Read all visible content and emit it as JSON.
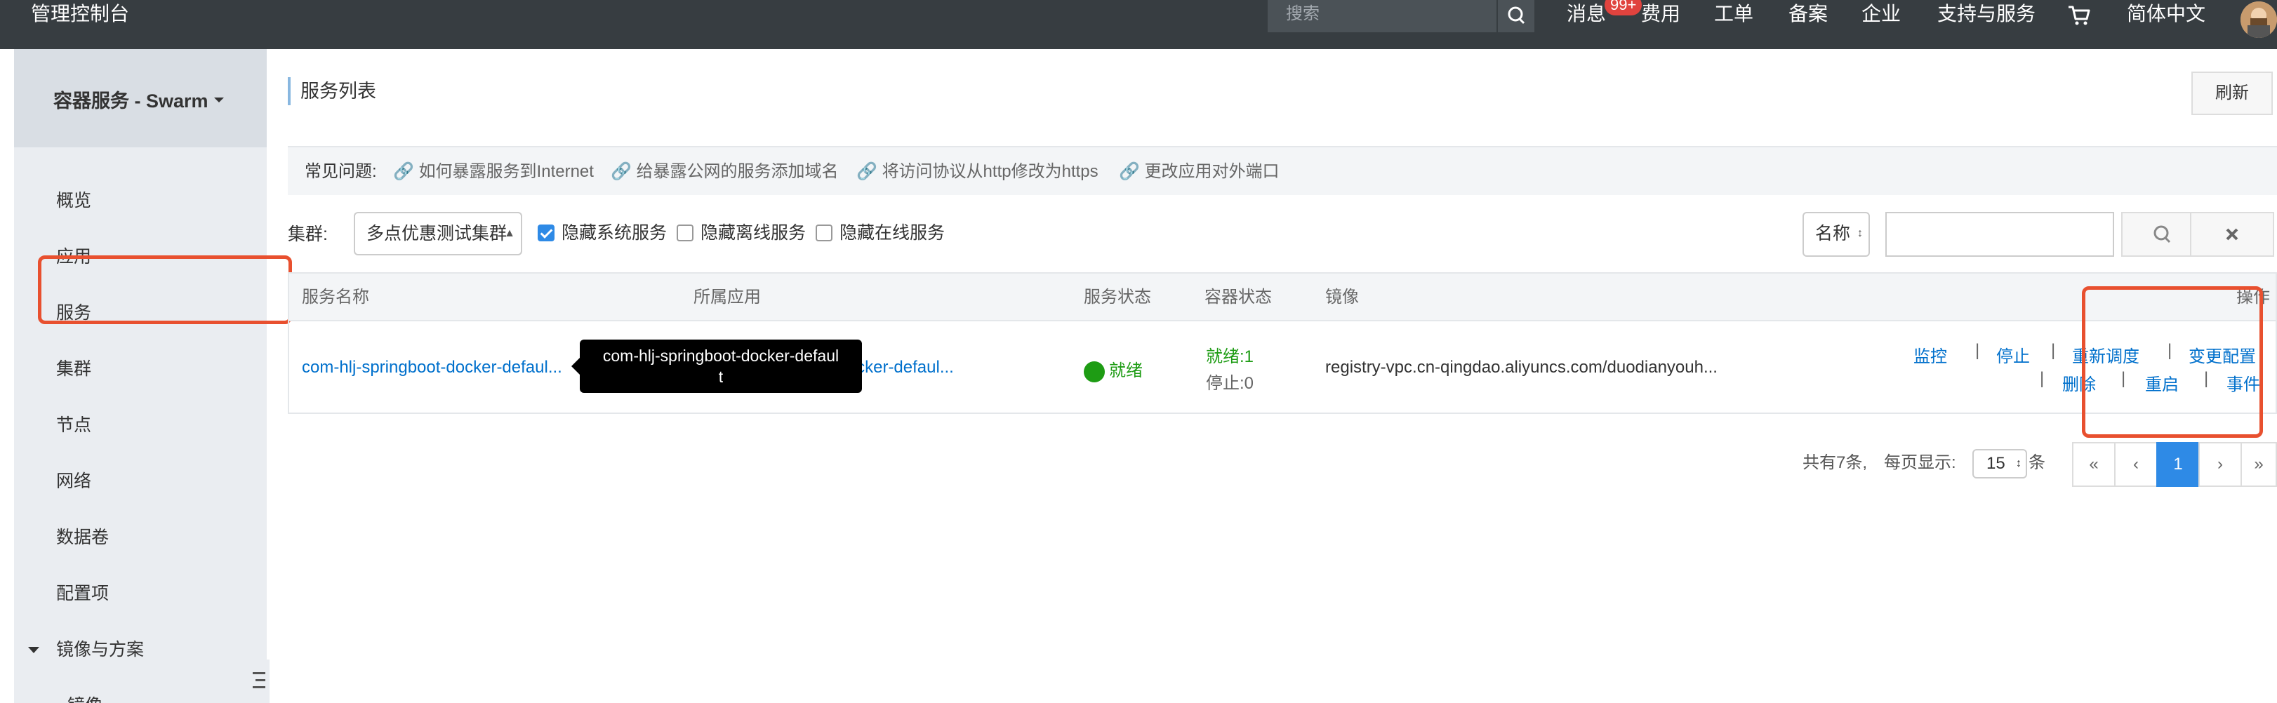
{
  "topbar": {
    "brand": "管理控制台",
    "search_placeholder": "搜索",
    "nav": [
      "消息",
      "费用",
      "工单",
      "备案",
      "企业",
      "支持与服务",
      "简体中文"
    ],
    "message_badge": "99+"
  },
  "sidebar": {
    "title": "容器服务 - Swarm",
    "items": [
      "概览",
      "应用",
      "服务",
      "集群",
      "节点",
      "网络",
      "数据卷",
      "配置项"
    ],
    "group": "镜像与方案",
    "sub_items": [
      "镜像"
    ]
  },
  "main": {
    "title": "服务列表",
    "refresh_label": "刷新",
    "faq_label": "常见问题:",
    "faq_links": [
      "如何暴露服务到Internet",
      "给暴露公网的服务添加域名",
      "将访问协议从http修改为https",
      "更改应用对外端口"
    ],
    "cluster_label": "集群:",
    "cluster_value": "多点优惠测试集群",
    "checkboxes": [
      {
        "label": "隐藏系统服务",
        "checked": true
      },
      {
        "label": "隐藏离线服务",
        "checked": false
      },
      {
        "label": "隐藏在线服务",
        "checked": false
      }
    ],
    "search_field_select": "名称"
  },
  "table": {
    "headers": [
      "服务名称",
      "所属应用",
      "服务状态",
      "容器状态",
      "镜像",
      "操作"
    ],
    "rows": [
      {
        "name": "com-hlj-springboot-docker-defaul...",
        "app": "com-hlj-springboot-docker-defaul...",
        "status": "就绪",
        "container_ready": "就绪:1",
        "container_stopped": "停止:0",
        "image": "registry-vpc.cn-qingdao.aliyuncs.com/duodianyouh...",
        "actions": [
          "监控",
          "停止",
          "重新调度",
          "变更配置",
          "删除",
          "重启",
          "事件"
        ]
      }
    ]
  },
  "tooltip": {
    "line1": "com-hlj-springboot-docker-defaul",
    "line2": "t"
  },
  "pagination": {
    "total": "共有7条,",
    "per_page_label": "每页显示:",
    "per_page_value": "15",
    "per_page_suffix": "条",
    "first": "«",
    "prev": "‹",
    "current": "1",
    "next": "›",
    "last": "»"
  },
  "colors": {
    "topbar": "#373d41",
    "link": "#0070cc",
    "ready": "#1e9c14",
    "highlight_box": "#e8502f",
    "primary": "#2e8ae6"
  }
}
